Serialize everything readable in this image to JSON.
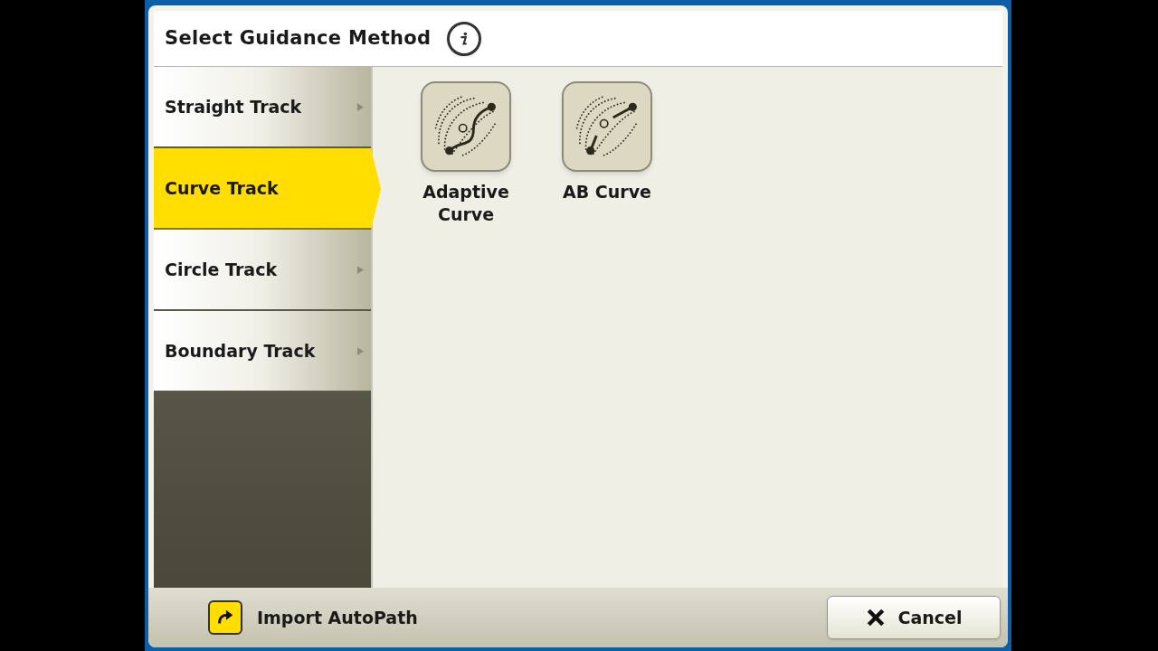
{
  "title": "Select Guidance Method",
  "menu": [
    {
      "label": "Straight Track",
      "selected": false
    },
    {
      "label": "Curve Track",
      "selected": true
    },
    {
      "label": "Circle Track",
      "selected": false
    },
    {
      "label": "Boundary Track",
      "selected": false
    }
  ],
  "methods": [
    {
      "label": "Adaptive Curve",
      "kind": "adaptive"
    },
    {
      "label": "AB Curve",
      "kind": "ab"
    }
  ],
  "footer": {
    "import_label": "Import AutoPath",
    "cancel_label": "Cancel"
  }
}
